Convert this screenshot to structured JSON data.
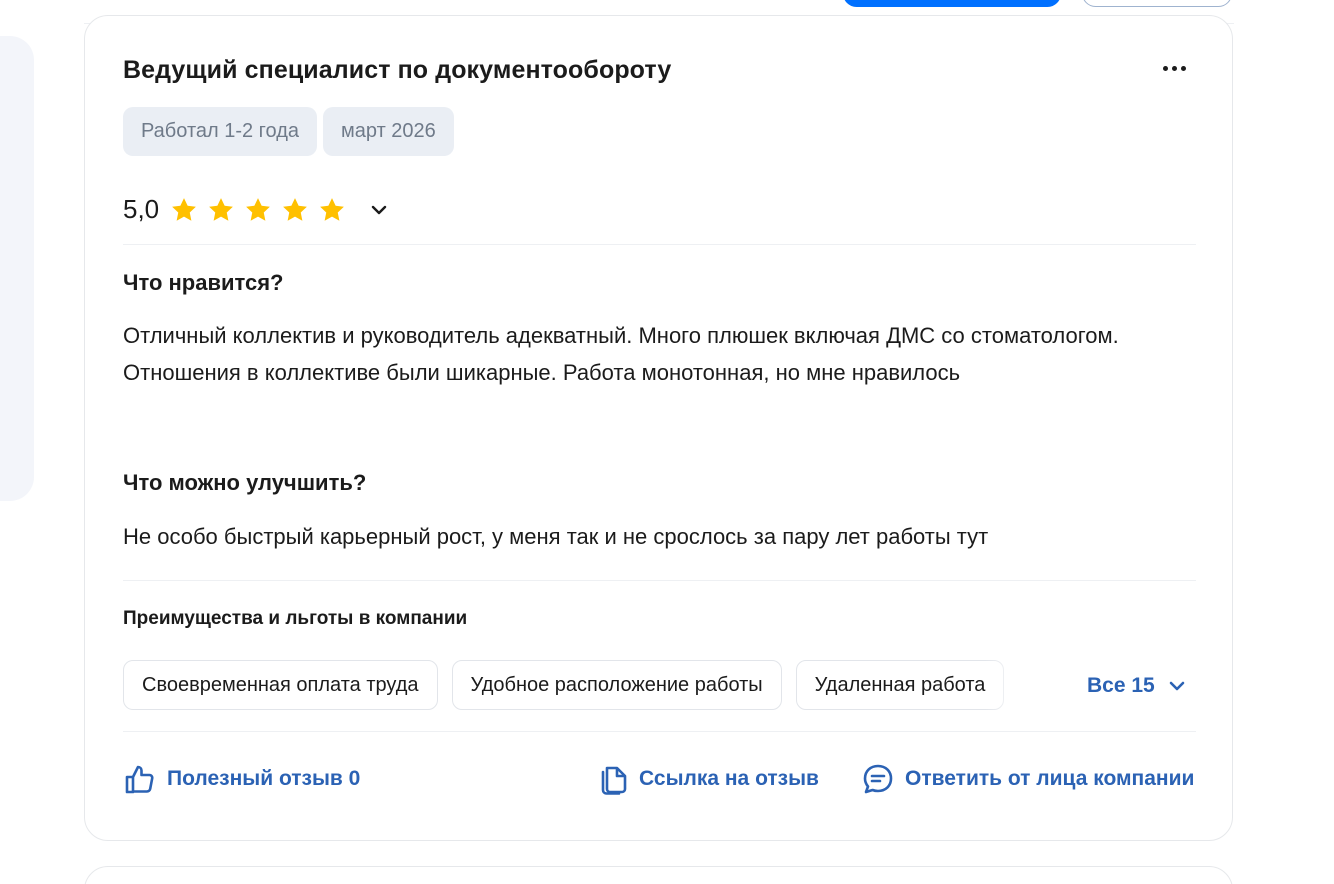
{
  "review": {
    "title": "Ведущий специалист по документообороту",
    "tags": [
      "Работал 1-2 года",
      "март 2026"
    ],
    "rating_value": "5,0",
    "stars": 5,
    "likes_heading": "Что нравится?",
    "likes_text": "Отличный коллектив и руководитель адекватный. Много плюшек включая ДМС со стоматологом. Отношения в коллективе были шикарные. Работа монотонная, но мне нравилось",
    "improve_heading": "Что можно улучшить?",
    "improve_text": "Не особо быстрый карьерный рост, у меня так и не срослось за пару лет работы тут",
    "benefits_heading": "Преимущества и льготы в компании",
    "benefits": [
      "Своевременная оплата труда",
      "Удобное расположение работы",
      "Удаленная работа"
    ],
    "all_benefits_label": "Все 15",
    "actions": {
      "helpful": "Полезный отзыв 0",
      "link": "Ссылка на отзыв",
      "reply": "Ответить от лица компании"
    }
  },
  "colors": {
    "accent": "#2b62b4",
    "star": "#ffc000",
    "tag_bg": "#eaeef4",
    "primary_button": "#0070ff"
  },
  "icons": {
    "more": "more-dots-icon",
    "expand": "chevron-down-icon",
    "helpful": "thumb-up-icon",
    "link": "copy-link-icon",
    "reply": "chat-bubble-icon"
  }
}
